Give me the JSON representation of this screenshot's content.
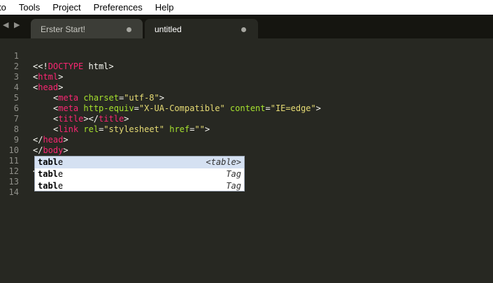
{
  "menu": {
    "items": [
      "to",
      "Tools",
      "Project",
      "Preferences",
      "Help"
    ]
  },
  "tabs": {
    "nav_arrows": "◀ ▶",
    "items": [
      {
        "label": "Erster Start!",
        "active": false
      },
      {
        "label": "untitled",
        "active": true
      }
    ]
  },
  "editor": {
    "line_numbers": [
      "1",
      "2",
      "3",
      "4",
      "5",
      "6",
      "7",
      "8",
      "9",
      "10",
      "11",
      "12",
      "13",
      "14"
    ],
    "typed_text": "<tabl",
    "lines": {
      "l1": {
        "lt": "<",
        "lt2": "<!",
        "kw": "DOCTYPE",
        "rest": " html",
        "gt": ">"
      },
      "l2": {
        "open": "<",
        "tag": "html",
        "close": ">"
      },
      "l3": {
        "open": "<",
        "tag": "head",
        "close": ">"
      },
      "l4": {
        "open": "<",
        "tag": "meta",
        "attr": "charset",
        "eq": "=",
        "val": "\"utf-8\"",
        "close": ">"
      },
      "l5": {
        "open": "<",
        "tag": "meta",
        "attr1": "http-equiv",
        "eq1": "=",
        "val1": "\"X-UA-Compatible\"",
        "attr2": "content",
        "eq2": "=",
        "val2": "\"IE=edge\"",
        "close": ">"
      },
      "l6": {
        "open": "<",
        "tag": "title",
        "mid": "></",
        "tag2": "title",
        "close": ">"
      },
      "l7": {
        "open": "<",
        "tag": "link",
        "attr1": "rel",
        "eq1": "=",
        "val1": "\"stylesheet\"",
        "attr2": "href",
        "eq2": "=",
        "val2": "\"\"",
        "close": ">"
      },
      "l8": {
        "open": "</",
        "tag": "head",
        "close": ">"
      },
      "l9": {
        "open": "</",
        "tag": "body",
        "close": ">"
      },
      "l11": {
        "open": "<",
        "tag": "tabl"
      }
    }
  },
  "autocomplete": {
    "items": [
      {
        "match": "tabl",
        "rest": "e",
        "hint": "<table>",
        "selected": true
      },
      {
        "match": "tabl",
        "rest": "e",
        "hint": "Tag",
        "selected": false
      },
      {
        "match": "tabl",
        "rest": "e",
        "hint": "Tag",
        "selected": false
      }
    ]
  },
  "colors": {
    "background": "#272822",
    "tag": "#f92672",
    "attribute": "#a6e22e",
    "string": "#e6db74",
    "text": "#f8f8f2",
    "selection": "#d5e1f2"
  }
}
